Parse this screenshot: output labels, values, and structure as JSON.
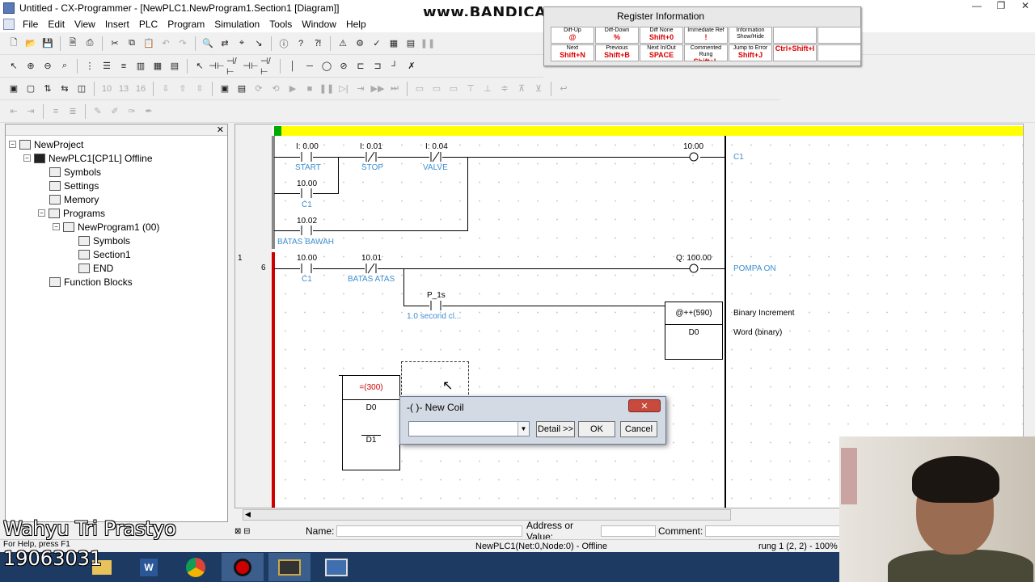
{
  "window": {
    "title": "Untitled - CX-Programmer - [NewPLC1.NewProgram1.Section1 [Diagram]]",
    "controls": [
      "—",
      "❐",
      "✕"
    ]
  },
  "watermark": "www.BANDICAM.com",
  "menu": [
    "File",
    "Edit",
    "View",
    "Insert",
    "PLC",
    "Program",
    "Simulation",
    "Tools",
    "Window",
    "Help"
  ],
  "help_panel": {
    "title": "Register Information",
    "cells": [
      {
        "top": "Diff-Up",
        "key": "@"
      },
      {
        "top": "Diff-Down",
        "key": "%"
      },
      {
        "top": "Diff None",
        "key": "Shift+0"
      },
      {
        "top": "Immediate Ref",
        "key": "!"
      },
      {
        "top": "Information",
        "key": "Show/Hide"
      },
      {
        "top": "Next",
        "key": "Shift+N"
      },
      {
        "top": "Previous",
        "key": "Shift+B"
      },
      {
        "top": "Next In/Out",
        "key": "SPACE"
      },
      {
        "top": "Commented Rung",
        "key": "Shift+L"
      },
      {
        "top": "Jump to Error",
        "key": "Shift+J"
      },
      {
        "top": "",
        "key": "Ctrl+Shift+I"
      }
    ]
  },
  "tree": {
    "items": [
      {
        "label": "NewProject"
      },
      {
        "label": "NewPLC1[CP1L] Offline"
      },
      {
        "label": "Symbols"
      },
      {
        "label": "Settings"
      },
      {
        "label": "Memory"
      },
      {
        "label": "Programs"
      },
      {
        "label": "NewProgram1 (00)"
      },
      {
        "label": "Symbols"
      },
      {
        "label": "Section1"
      },
      {
        "label": "END"
      },
      {
        "label": "Function Blocks"
      }
    ]
  },
  "ladder": {
    "rung0": {
      "contacts": [
        {
          "addr": "I: 0.00",
          "name": "START"
        },
        {
          "addr": "I: 0.01",
          "name": "STOP"
        },
        {
          "addr": "I: 0.04",
          "name": "VALVE"
        },
        {
          "addr": "10.00",
          "name": "C1"
        },
        {
          "addr": "10.02",
          "name": "BATAS BAWAH"
        }
      ],
      "coil": {
        "addr": "10.00",
        "name": "C1"
      }
    },
    "rung1": {
      "rung_number": "1",
      "step": "6",
      "contacts": [
        {
          "addr": "10.00",
          "name": "C1"
        },
        {
          "addr": "10.01",
          "name": "BATAS ATAS"
        },
        {
          "addr": "P_1s",
          "name": "1.0 second cl..."
        }
      ],
      "coil": {
        "addr": "Q: 100.00",
        "name": "POMPA ON"
      },
      "instr": {
        "op": "@++(590)",
        "operand": "D0",
        "desc1": "Binary Increment",
        "desc2": "Word (binary)"
      },
      "cmp": {
        "op": "=(300)",
        "op1": "D0",
        "op2": "D1"
      }
    }
  },
  "dialog": {
    "title": "-( )- New Coil",
    "close": "✕",
    "combo_value": "",
    "detail": "Detail >>",
    "ok": "OK",
    "cancel": "Cancel"
  },
  "infobar": {
    "name_label": "Name:",
    "address_label": "Address or Value:",
    "comment_label": "Comment:"
  },
  "status": {
    "help": "For Help, press F1",
    "plc": "NewPLC1(Net:0,Node:0) - Offline",
    "pos": "rung 1 (2, 2)  - 100%"
  },
  "overlay": {
    "name": "Wahyu Tri Prastyo",
    "id": "19063031"
  }
}
